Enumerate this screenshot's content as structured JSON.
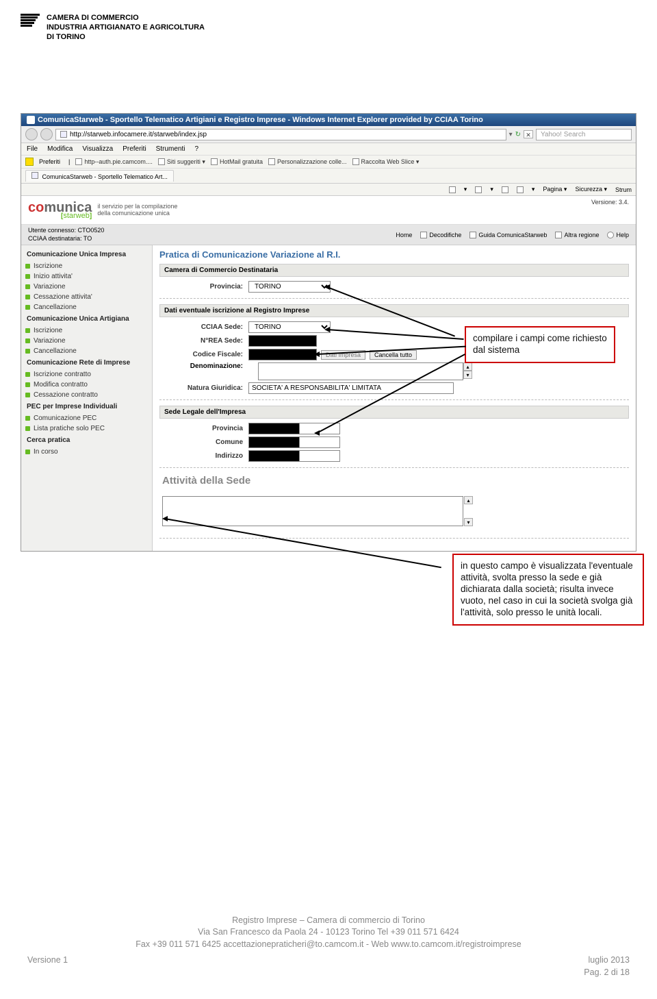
{
  "header": {
    "org_line1": "CAMERA DI COMMERCIO",
    "org_line2": "INDUSTRIA ARTIGIANATO E AGRICOLTURA",
    "org_line3": "DI TORINO"
  },
  "browser": {
    "title": "ComunicaStarweb - Sportello Telematico Artigiani e Registro Imprese - Windows Internet Explorer provided by CCIAA Torino",
    "url": "http://starweb.infocamere.it/starweb/index.jsp",
    "search_placeholder": "Yahoo! Search",
    "menu": [
      "File",
      "Modifica",
      "Visualizza",
      "Preferiti",
      "Strumenti",
      "?"
    ],
    "fav_label": "Preferiti",
    "fav_items": [
      "http--auth.pie.camcom....",
      "Siti suggeriti ▾",
      "HotMail gratuita",
      "Personalizzazione colle...",
      "Raccolta Web Slice ▾"
    ],
    "tab": "ComunicaStarweb - Sportello Telematico Art...",
    "toolbar": [
      "Pagina ▾",
      "Sicurezza ▾",
      "Strum"
    ]
  },
  "app": {
    "logo_co": "co",
    "logo_munica": "munica",
    "starweb": "starweb",
    "tagline1": "il servizio per la compilazione",
    "tagline2": "della comunicazione unica",
    "version": "Versione: 3.4.",
    "user_line1": "Utente connesso: CTO0520",
    "user_line2": "CCIAA destinataria: TO",
    "topnav": [
      "Home",
      "Decodifiche",
      "Guida ComunicaStarweb",
      "Altra regione",
      "Help"
    ]
  },
  "sidebar": {
    "groups": [
      {
        "title": "Comunicazione Unica Impresa",
        "items": [
          "Iscrizione",
          "Inizio attivita'",
          "Variazione",
          "Cessazione attivita'",
          "Cancellazione"
        ]
      },
      {
        "title": "Comunicazione Unica Artigiana",
        "items": [
          "Iscrizione",
          "Variazione",
          "Cancellazione"
        ]
      },
      {
        "title": "Comunicazione Rete di Imprese",
        "items": [
          "Iscrizione contratto",
          "Modifica contratto",
          "Cessazione contratto"
        ]
      },
      {
        "title": "PEC per Imprese Individuali",
        "items": [
          "Comunicazione PEC",
          "Lista pratiche solo PEC"
        ]
      },
      {
        "title": "Cerca pratica",
        "items": [
          "In corso"
        ]
      }
    ]
  },
  "form": {
    "title": "Pratica di Comunicazione Variazione al R.I.",
    "section1": "Camera di Commercio Destinataria",
    "provincia_label": "Provincia:",
    "provincia_value": "TORINO",
    "section2": "Dati eventuale iscrizione al Registro Imprese",
    "cciaa_label": "CCIAA Sede:",
    "cciaa_value": "TORINO",
    "nrea_label": "N°REA Sede:",
    "cf_label": "Codice Fiscale:",
    "btn_dati": "Dati Impresa",
    "btn_cancella": "Cancella tutto",
    "denom_label": "Denominazione:",
    "natura_label": "Natura Giuridica:",
    "natura_value": "SOCIETA' A RESPONSABILITA' LIMITATA",
    "section3": "Sede Legale dell'Impresa",
    "prov2_label": "Provincia",
    "comune_label": "Comune",
    "indirizzo_label": "Indirizzo",
    "activity_title": "Attività della Sede"
  },
  "callouts": {
    "c1": "compilare i campi come richiesto dal sistema",
    "c2": "in questo campo è visualizzata l'eventuale attività, svolta presso la sede e già dichiarata dalla società; risulta invece vuoto, nel caso in cui la società svolga già l'attività, solo presso le unità locali."
  },
  "footer": {
    "line1": "Registro Imprese – Camera di commercio di Torino",
    "line2": "Via San Francesco da Paola 24 - 10123 Torino Tel +39 011 571 6424",
    "line3": "Fax +39 011 571 6425 accettazionepraticheri@to.camcom.it  - Web www.to.camcom.it/registroimprese",
    "version": "Versione 1",
    "date": "luglio 2013",
    "page": "Pag. 2 di 18"
  }
}
